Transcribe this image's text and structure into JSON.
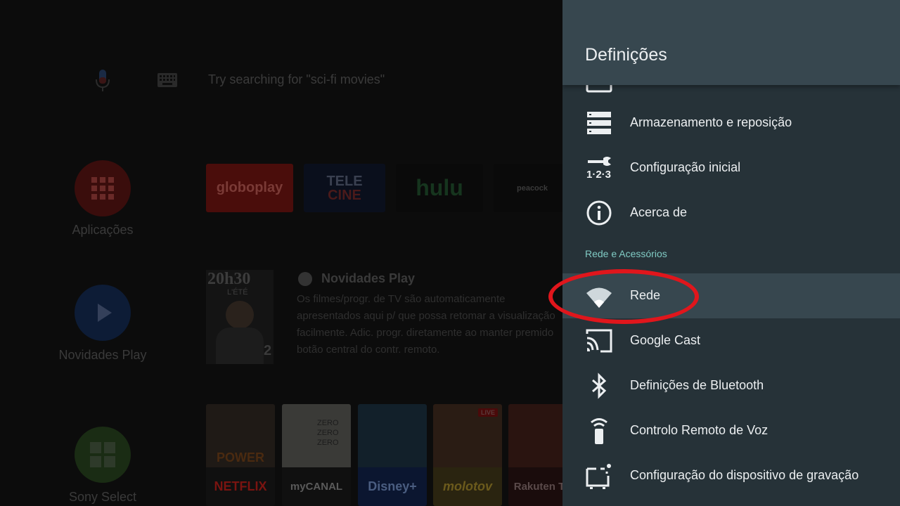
{
  "home": {
    "search_hint": "Try searching for \"sci-fi movies\"",
    "rail": {
      "apps_label": "Aplicações",
      "play_next_label": "Novidades Play",
      "sony_select_label": "Sony Select"
    },
    "apps_row": [
      {
        "name": "globoplay"
      },
      {
        "name": "TELE"
      },
      {
        "name": "CINE"
      },
      {
        "name": "hulu"
      },
      {
        "name": "peacock"
      }
    ],
    "play_next": {
      "title": "Novidades Play",
      "description": "Os filmes/progr. de TV são automaticamente apresentados aqui p/ que possa retomar a visualização facilmente. Adic. progr. diretamente ao manter premido botão central do contr. remoto.",
      "thumb_title": "20h30",
      "thumb_sub": "L'ÉTÉ",
      "thumb_channel": "2"
    },
    "posters": [
      {
        "caption": "POWER",
        "brand": "NETFLIX",
        "art_color": "#1f1a16",
        "brand_color": "#7a1410",
        "brand_bg": "#101010"
      },
      {
        "caption": "ZERO ZERO ZERO",
        "brand": "myCANAL",
        "art_color": "#3a3a37",
        "brand_bg": "#101010",
        "brand_color": "#5a5a5a"
      },
      {
        "caption": "",
        "brand": "Disney+",
        "art_color": "#12202a",
        "brand_bg": "#0b1630",
        "brand_color": "#4a5d80"
      },
      {
        "caption": "LIVE",
        "brand": "molotov",
        "art_color": "#2a1c14",
        "brand_bg": "#2a2410",
        "brand_color": "#6b5a1c"
      },
      {
        "caption": "",
        "brand": "Rakuten TV",
        "art_color": "#2a1410",
        "brand_bg": "#1a0c0c",
        "brand_color": "#5a4a4a"
      }
    ]
  },
  "settings": {
    "title": "Definições",
    "section_label": "Rede e Acessórios",
    "items": [
      {
        "label": "Armazenamento e reposição",
        "icon": "storage-icon"
      },
      {
        "label": "Configuração inicial",
        "icon": "initial-setup-icon"
      },
      {
        "label": "Acerca de",
        "icon": "info-icon"
      },
      {
        "label": "Rede",
        "icon": "wifi-icon",
        "selected": true
      },
      {
        "label": "Google Cast",
        "icon": "cast-icon"
      },
      {
        "label": "Definições de Bluetooth",
        "icon": "bluetooth-icon"
      },
      {
        "label": "Controlo Remoto de Voz",
        "icon": "remote-icon"
      },
      {
        "label": "Configuração do dispositivo de gravação",
        "icon": "recording-device-icon"
      }
    ],
    "setup_icon_digits": "1·2·3"
  },
  "colors": {
    "panel_bg": "#263238",
    "header_bg": "#37474f",
    "selected_bg": "#37474f",
    "section_accent": "#80cbc4",
    "highlight_ring": "#e0161c"
  }
}
